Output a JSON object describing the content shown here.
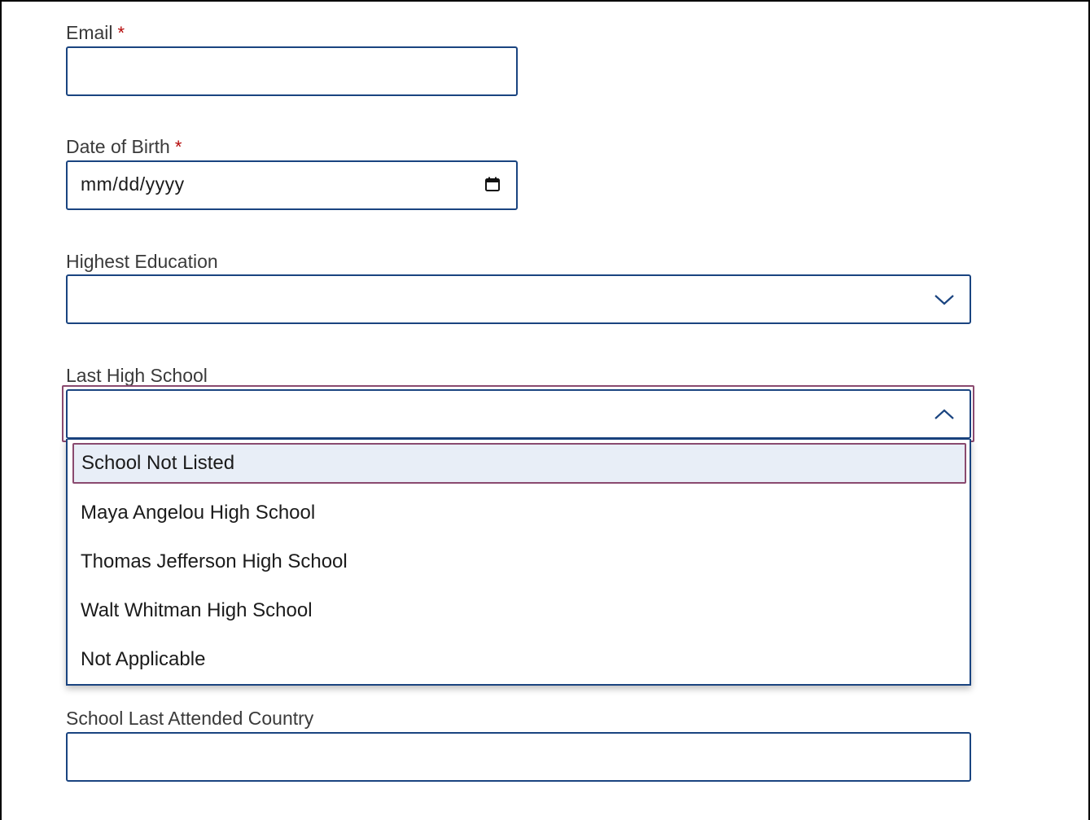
{
  "email": {
    "label": "Email",
    "required_mark": "*",
    "value": ""
  },
  "dob": {
    "label": "Date of Birth",
    "required_mark": "*",
    "placeholder": "mm/dd/yyyy",
    "icon": "calendar-icon"
  },
  "education": {
    "label": "Highest Education",
    "value": "",
    "icon": "chevron-down-icon"
  },
  "high_school": {
    "label": "Last High School",
    "value": "",
    "icon": "chevron-up-icon",
    "options": [
      "School Not Listed",
      "Maya Angelou High School",
      "Thomas Jefferson High School",
      "Walt Whitman High School",
      "Not Applicable"
    ]
  },
  "country": {
    "label": "School Last Attended Country",
    "value": ""
  },
  "colors": {
    "border": "#1a4480",
    "focus": "#8a4a6f",
    "required": "#b50909",
    "highlight": "#e8eef7"
  }
}
